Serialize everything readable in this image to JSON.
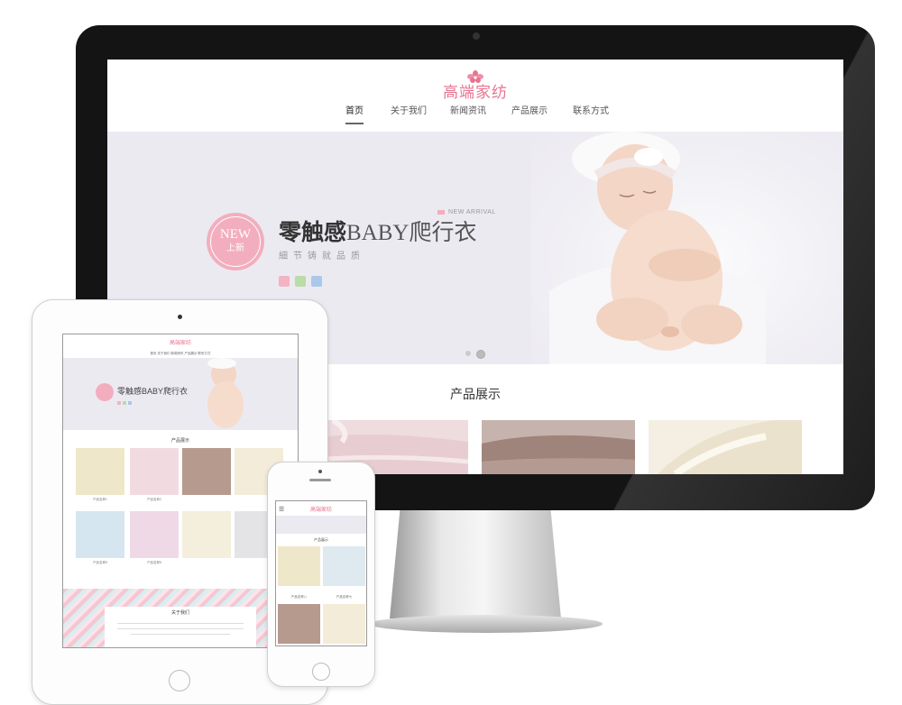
{
  "desktop": {
    "logo": "高端家纺",
    "nav": [
      "首页",
      "关于我们",
      "新闻资讯",
      "产品展示",
      "联系方式"
    ],
    "banner": {
      "badge_top": "NEW",
      "badge_bottom": "上新",
      "arrival": "NEW ARRIVAL",
      "headline_bold": "零触感",
      "headline_light": "BABY爬行衣",
      "tagline": "細节铸就品质",
      "swatch_colors": [
        "#f2b3c2",
        "#b9dca8",
        "#a9c8ea"
      ]
    },
    "section_title": "产品展示"
  },
  "tablet": {
    "logo": "高端家纺",
    "nav": "首页    关于我们    新闻资讯    产品展示    联系方式",
    "headline": "零触感BABY爬行衣",
    "section_title": "产品展示",
    "captions": [
      "产品名称1",
      "产品名称2",
      "",
      "",
      "产品名称5",
      "产品名称6",
      "",
      ""
    ],
    "about_title": "关于我们"
  },
  "phone": {
    "menu": "☰",
    "logo": "高端家纺",
    "section_title": "产品展示",
    "captions": [
      "产品名称八",
      "产品名称七"
    ]
  },
  "colors": {
    "brand_pink": "#e7738f",
    "badge_pink": "#f2aebe",
    "banner_bg": "#eceaf1"
  }
}
